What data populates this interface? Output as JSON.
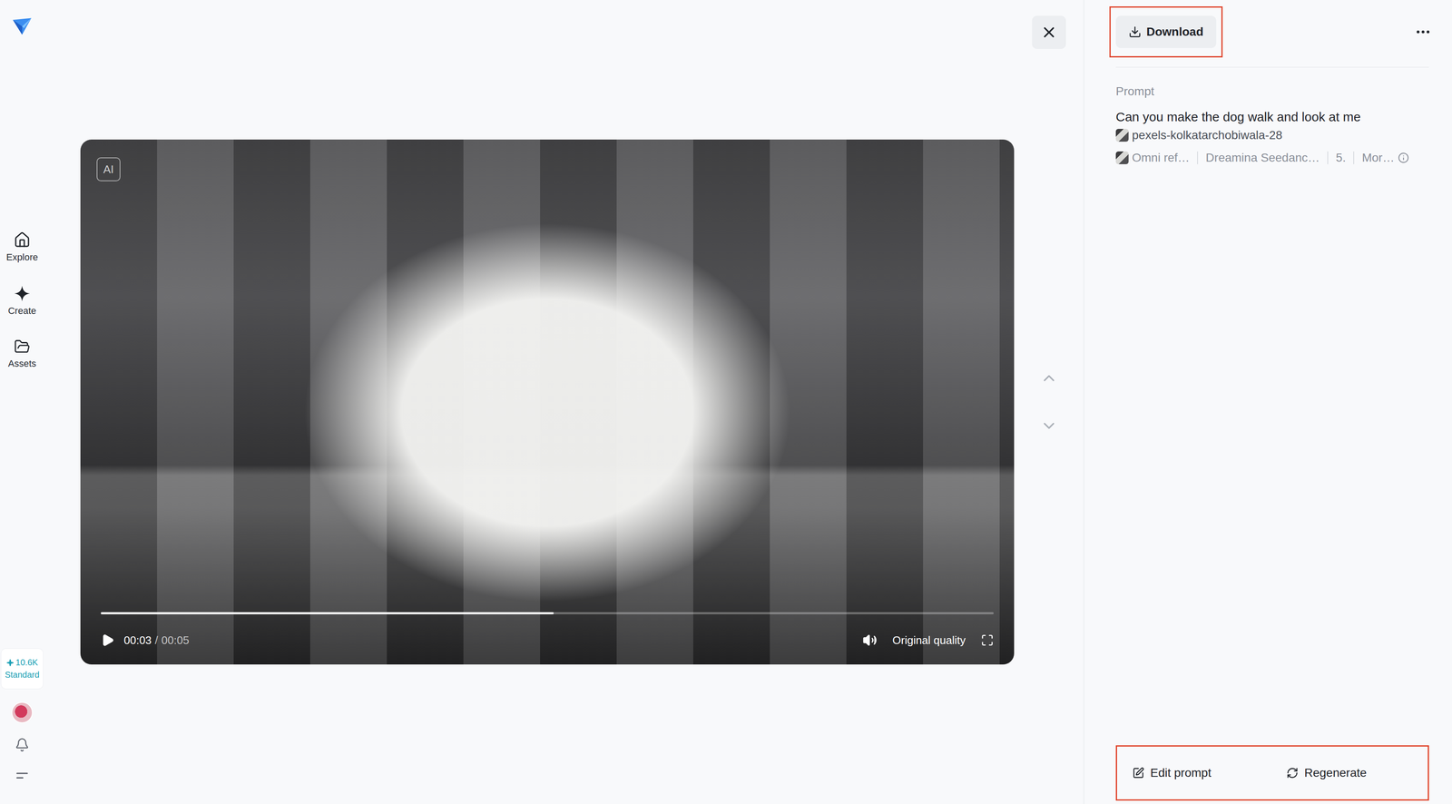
{
  "sidebar": {
    "items": [
      {
        "label": "Explore",
        "selected": false
      },
      {
        "label": "Create",
        "selected": false
      },
      {
        "label": "Assets",
        "selected": false
      }
    ],
    "credits": "10.6K",
    "plan": "Standard"
  },
  "player": {
    "badge": "AI",
    "time": "00:03",
    "separator": "/",
    "duration": "00:05",
    "quality": "Original quality",
    "level": 0.507,
    "playing": false
  },
  "download": {
    "label": "Download"
  },
  "prompt": {
    "label": "Prompt",
    "text": "Can you make the dog walk and look at me",
    "reference": "pexels-kolkatarchobiwala-28"
  },
  "meta": [
    {
      "label": "Omni ref…",
      "kind": "reference"
    },
    {
      "label": "Dreamina Seedanc…",
      "kind": "text"
    },
    {
      "label": "5.",
      "kind": "text"
    },
    {
      "label": "Mor…",
      "kind": "info"
    }
  ],
  "actions": [
    {
      "label": "Edit prompt",
      "kind": "edit"
    },
    {
      "label": "Regenerate",
      "kind": "regenerate"
    }
  ]
}
